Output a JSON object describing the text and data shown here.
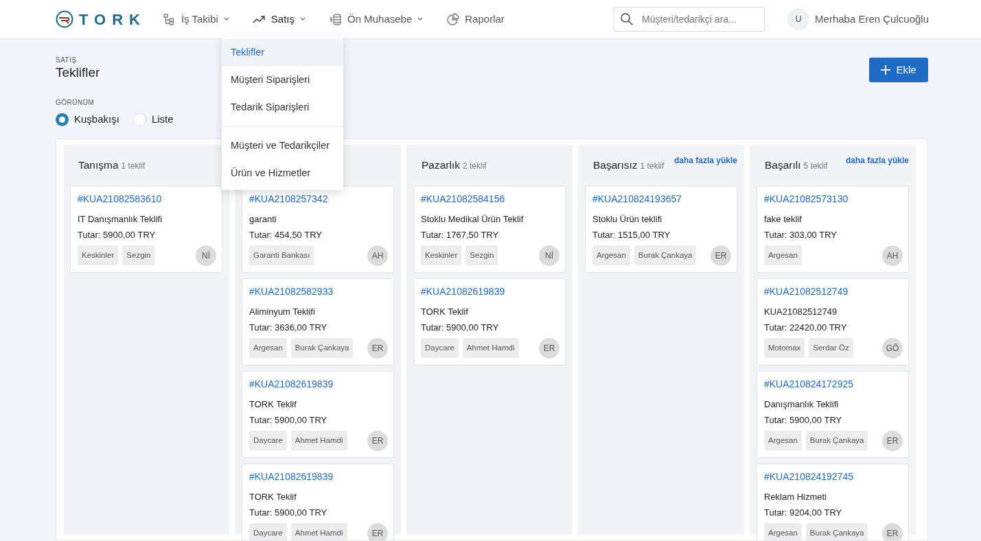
{
  "brand": {
    "name": "TORK"
  },
  "nav": [
    {
      "label": "İş Takibi",
      "kind": "tree",
      "caret": true,
      "selected": false
    },
    {
      "label": "Satış",
      "kind": "trend",
      "caret": true,
      "selected": true
    },
    {
      "label": "Ön Muhasebe",
      "kind": "coins",
      "caret": true,
      "selected": false
    },
    {
      "label": "Raporlar",
      "kind": "pie",
      "caret": false,
      "selected": false
    }
  ],
  "search": {
    "placeholder": "Müşteri/tedarikçi ara..."
  },
  "user": {
    "initial": "U",
    "greeting": "Merhaba Eren Çulcuoğlu"
  },
  "dropdown": {
    "groups": [
      {
        "items": [
          {
            "label": "Teklifler",
            "selected": true
          },
          {
            "label": "Müşteri Siparişleri",
            "selected": false
          },
          {
            "label": "Tedarik Siparişleri",
            "selected": false
          }
        ]
      },
      {
        "items": [
          {
            "label": "Müşteri ve Tedarikçiler",
            "selected": false
          },
          {
            "label": "Ürün ve Hizmetler",
            "selected": false
          }
        ]
      }
    ]
  },
  "breadcrumb": "SATIŞ",
  "title": "Teklifler",
  "add_button": "Ekle",
  "view": {
    "label": "GÖRÜNÜM",
    "options": [
      {
        "label": "Kuşbakışı",
        "selected": true
      },
      {
        "label": "Liste",
        "selected": false
      }
    ]
  },
  "columns": [
    {
      "title": "Tanışma",
      "count": "1 teklif",
      "cards": [
        {
          "code": "#KUA21082583610",
          "title": "IT Danışmanlık Teklifi",
          "amount": "Tutar: 5900,00 TRY",
          "tags": [
            "Keskinler",
            "Sezgin"
          ],
          "avatar": "Nİ"
        }
      ]
    },
    {
      "cards": [
        {
          "code": "#KUA2108257342",
          "title": "garanti",
          "amount": "Tutar: 454,50 TRY",
          "tags": [
            "Garanti Bankası"
          ],
          "avatar": "AH"
        },
        {
          "code": "#KUA21082582933",
          "title": "Aliminyum Teklifi",
          "amount": "Tutar: 3636,00 TRY",
          "tags": [
            "Argesan",
            "Burak Çankaya"
          ],
          "avatar": "ER"
        },
        {
          "code": "#KUA21082619839",
          "title": "TORK Teklif",
          "amount": "Tutar: 5900,00 TRY",
          "tags": [
            "Daycare",
            "Ahmet Hamdi"
          ],
          "avatar": "ER"
        },
        {
          "code": "#KUA21082619839",
          "title": "TORK Teklif",
          "amount": "Tutar: 5900,00 TRY",
          "tags": [
            "Daycare",
            "Ahmet Hamdi"
          ],
          "avatar": "ER"
        }
      ]
    },
    {
      "title": "Pazarlık",
      "count": "2 teklif",
      "cards": [
        {
          "code": "#KUA21082584156",
          "title": "Stoklu Medikal Ürün Teklif",
          "amount": "Tutar: 1767,50 TRY",
          "tags": [
            "Keskinler",
            "Sezgin"
          ],
          "avatar": "Nİ"
        },
        {
          "code": "#KUA21082619839",
          "title": "TORK Teklif",
          "amount": "Tutar: 5900,00 TRY",
          "tags": [
            "Daycare",
            "Ahmet Hamdi"
          ],
          "avatar": "ER"
        }
      ]
    },
    {
      "title": "Başarısız",
      "count": "1 teklif",
      "load_more": "daha fazla yükle",
      "cards": [
        {
          "code": "#KUA210824193657",
          "title": "Stoklu Ürün teklifi",
          "amount": "Tutar: 1515,00 TRY",
          "tags": [
            "Argesan",
            "Burak Çankaya"
          ],
          "avatar": "ER"
        }
      ]
    },
    {
      "title": "Başarılı",
      "count": "5 teklif",
      "load_more": "daha fazla yükle",
      "cards": [
        {
          "code": "#KUA21082573130",
          "title": "fake teklif",
          "amount": "Tutar: 303,00 TRY",
          "tags": [
            "Argesan"
          ],
          "avatar": "AH"
        },
        {
          "code": "#KUA21082512749",
          "title": "KUA21082512749",
          "amount": "Tutar: 22420,00 TRY",
          "tags": [
            "Motomax",
            "Serdar Öz"
          ],
          "avatar": "GÖ"
        },
        {
          "code": "#KUA210824172925",
          "title": "Danışmanlık Teklifi",
          "amount": "Tutar: 5900,00 TRY",
          "tags": [
            "Argesan",
            "Burak Çankaya"
          ],
          "avatar": "ER"
        },
        {
          "code": "#KUA210824192745",
          "title": "Reklam Hizmeti",
          "amount": "Tutar: 9204,00 TRY",
          "tags": [
            "Argesan",
            "Burak Çankaya"
          ],
          "avatar": "ER"
        }
      ]
    }
  ]
}
